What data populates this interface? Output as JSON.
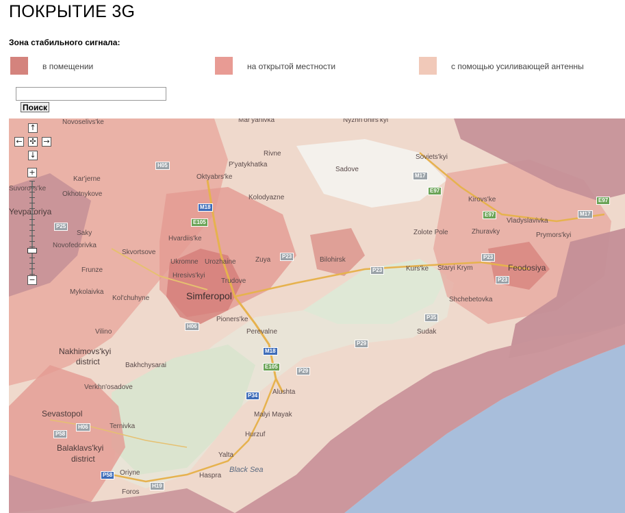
{
  "page": {
    "title": "ПОКРЫТИЕ 3G"
  },
  "legend": {
    "heading": "Зона стабильного сигнала:",
    "items": [
      {
        "label": "в помещении",
        "color": "#d4837d"
      },
      {
        "label": "на открытой местности",
        "color": "#e89b94"
      },
      {
        "label": "с помощью усиливающей антенны",
        "color": "#f1c9b9"
      }
    ]
  },
  "search": {
    "value": "",
    "button_label": "Поиск"
  },
  "map": {
    "controls": {
      "pan_up": "↑",
      "pan_left": "←",
      "pan_center": "✣",
      "pan_right": "→",
      "pan_down": "↓",
      "zoom_in": "+",
      "zoom_out": "−"
    },
    "places": {
      "novoselivske": "Novoselivs'ke",
      "maryanivka": "Mar'yanivka",
      "nyzhnohirskyi": "Nyzhn'ohirs'kyi",
      "rivne": "Rivne",
      "sadove": "Sadove",
      "sovietskyi": "Soviets'kyi",
      "karjerne": "Kar'jerne",
      "pyatykhatka": "P'yatykhatka",
      "oktyabrske": "Oktyabrs'ke",
      "okhotnykove": "Okhotnykove",
      "suvorovske": "Suvorovs'ke",
      "yevpatoriya": "Yevpatoriya",
      "kolodyazne": "Kolodyazne",
      "kirovske": "Kirovs'ke",
      "vladyslavivka": "Vladyslavivka",
      "saky": "Saky",
      "novofedorivka": "Novofedorivka",
      "hvardiiske": "Hvardiis'ke",
      "zolote_pole": "Zolote Pole",
      "zhuravky": "Zhuravky",
      "prymorskyi": "Prymors'kyi",
      "skvortsove": "Skvortsove",
      "ukromne": "Ukromne",
      "urozhaine": "Urozhaine",
      "zuya": "Zuya",
      "bilohirsk": "Bilohirsk",
      "kurske": "Kurs'ke",
      "staryi_krym": "Staryi Krym",
      "feodosiya": "Feodosiya",
      "frunze": "Frunze",
      "hresivskyi": "Hresivs'kyi",
      "trudove": "Trudove",
      "mykolaivka": "Mykolaivka",
      "simferopol": "Simferopol",
      "kolchuhyne": "Kol'chuhyne",
      "shchebetovka": "Shchebetovka",
      "pionerske": "Pioners'ke",
      "perevalne": "Perevalne",
      "sudak": "Sudak",
      "vilino": "Vilino",
      "nakhimovskyi": "Nakhimovs'kyi",
      "district1": "district",
      "bakhchysarai": "Bakhchysarai",
      "verkhnosadove": "Verkhn'osadove",
      "alushta": "Alushta",
      "sevastopol": "Sevastopol",
      "malyi_mayak": "Malyi Mayak",
      "ternivka": "Ternivka",
      "hurzuf": "Hurzuf",
      "balaklavskyi": "Balaklavs'kyi",
      "district2": "district",
      "yalta": "Yalta",
      "black_sea": "Black Sea",
      "hasprа": "Haspra",
      "oriyne": "Oriyne",
      "foros": "Foros"
    },
    "roads": {
      "h05": "H05",
      "m17a": "M17",
      "e97a": "E97",
      "m18a": "M18",
      "e105a": "E105",
      "e97b": "E97",
      "e97c": "E97",
      "m17b": "M17",
      "p25": "P25",
      "p23a": "P23",
      "p23b": "P23",
      "p23c": "P23",
      "p23d": "P23",
      "h06": "H06",
      "p35": "P35",
      "p29a": "P29",
      "m18b": "M18",
      "e105b": "E105",
      "p29b": "P29",
      "p34": "P34",
      "p58": "P58",
      "h06b": "H06",
      "p35b": "P35",
      "p58b": "P58",
      "h19": "H19"
    }
  }
}
